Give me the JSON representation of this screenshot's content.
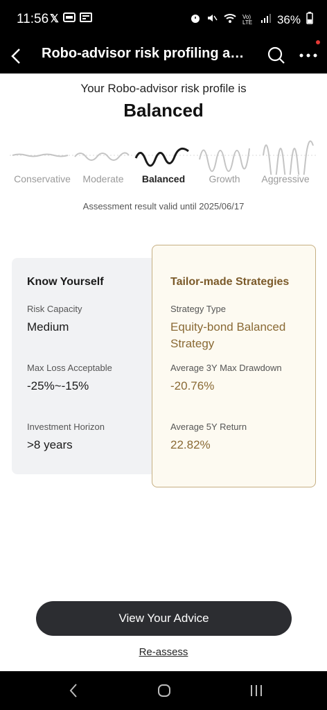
{
  "status_bar": {
    "time": "11:56",
    "battery": "36%",
    "network_label": "Vo) LTE"
  },
  "app_bar": {
    "title": "Robo-advisor risk profiling and..."
  },
  "profile": {
    "intro": "Your Robo-advisor risk profile is",
    "result": "Balanced",
    "levels": [
      "Conservative",
      "Moderate",
      "Balanced",
      "Growth",
      "Aggressive"
    ],
    "active_level": "Balanced",
    "validity": "Assessment result valid until 2025/06/17"
  },
  "know_yourself": {
    "title": "Know Yourself",
    "items": [
      {
        "label": "Risk Capacity",
        "value": "Medium"
      },
      {
        "label": "Max Loss Acceptable",
        "value": "-25%~-15%"
      },
      {
        "label": "Investment Horizon",
        "value": ">8 years"
      }
    ]
  },
  "strategies": {
    "title": "Tailor-made Strategies",
    "items": [
      {
        "label": "Strategy Type",
        "value": "Equity-bond Balanced Strategy"
      },
      {
        "label": "Average 3Y Max Drawdown",
        "value": "-20.76%"
      },
      {
        "label": "Average 5Y Return",
        "value": "22.82%"
      }
    ]
  },
  "actions": {
    "primary": "View Your Advice",
    "secondary": "Re-assess"
  },
  "colors": {
    "accent_gold": "#8a6a35",
    "card_border": "#c5ae82",
    "button_bg": "#2c2d31"
  }
}
